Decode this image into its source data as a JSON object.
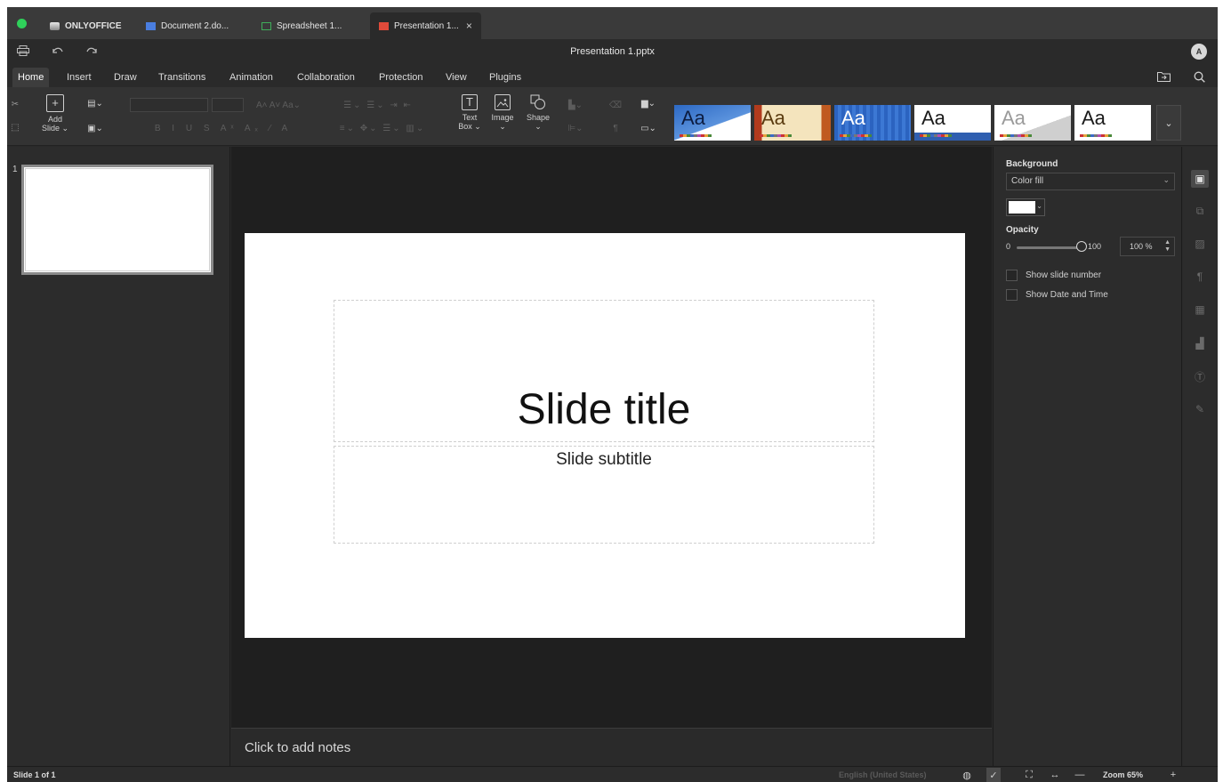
{
  "window": {
    "tabs": [
      {
        "label": "ONLYOFFICE"
      },
      {
        "label": "Document 2.do..."
      },
      {
        "label": "Spreadsheet 1..."
      },
      {
        "label": "Presentation 1...",
        "close": "×"
      }
    ]
  },
  "titlebar": {
    "title": "Presentation 1.pptx",
    "avatar": "A"
  },
  "ribbon": {
    "tabs": [
      "Home",
      "Insert",
      "Draw",
      "Transitions",
      "Animation",
      "Collaboration",
      "Protection",
      "View",
      "Plugins"
    ],
    "active_tab": "Home"
  },
  "toolbar": {
    "add_slide": {
      "line1": "Add",
      "line2": "Slide ⌄"
    },
    "text_box": {
      "line1": "Text",
      "line2": "Box ⌄"
    },
    "image": "Image",
    "shape": "Shape",
    "themes": [
      "Aa",
      "Aa",
      "Aa",
      "Aa",
      "Aa",
      "Aa"
    ]
  },
  "thumbnails": {
    "number": "1"
  },
  "slide": {
    "title": "Slide title",
    "subtitle": "Slide subtitle"
  },
  "notes": {
    "placeholder": "Click to add notes"
  },
  "settings": {
    "background_label": "Background",
    "fill_value": "Color fill",
    "fill_color": "#ffffff",
    "opacity_label": "Opacity",
    "opacity_min": "0",
    "opacity_max": "100",
    "opacity_value": "100 %",
    "show_slide_number": "Show slide number",
    "show_date_time": "Show Date and Time"
  },
  "statusbar": {
    "slide_count": "Slide 1 of 1",
    "language": "English (United States)",
    "zoom": "Zoom 65%",
    "zoom_minus": "—",
    "zoom_plus": "+"
  },
  "colors": {
    "accent_green": "#2fd05a",
    "doc_blue": "#4a7ee0",
    "sheet_green": "#3fae5a",
    "pres_red": "#e04a3a"
  }
}
